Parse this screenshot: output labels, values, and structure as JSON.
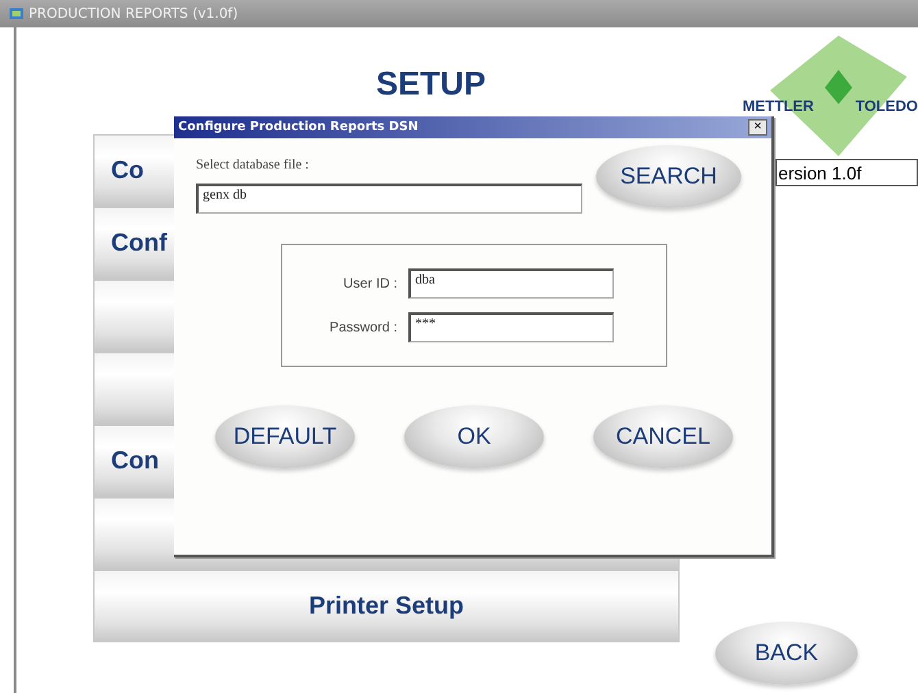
{
  "window": {
    "title": "PRODUCTION REPORTS (v1.0f)"
  },
  "heading": "SETUP",
  "logo": {
    "left": "METTLER",
    "right": "TOLEDO"
  },
  "version": "ersion 1.0f",
  "menu": [
    {
      "label": "Co",
      "kind": "partial"
    },
    {
      "label": "Conf",
      "kind": "partial"
    },
    {
      "kind": "hidden"
    },
    {
      "kind": "hidden"
    },
    {
      "label": "Con",
      "kind": "partial"
    },
    {
      "kind": "hidden"
    },
    {
      "label": "Printer Setup",
      "kind": "full"
    }
  ],
  "back_button": "BACK",
  "dialog": {
    "title": "Configure Production Reports DSN",
    "close": "×",
    "file_label": "Select database file :",
    "file_value": "genx db",
    "search_button": "SEARCH",
    "fields": [
      {
        "label": "User ID :",
        "value": "dba"
      },
      {
        "label": "Password :",
        "value": "***"
      }
    ],
    "buttons": [
      "DEFAULT",
      "OK",
      "CANCEL"
    ]
  }
}
